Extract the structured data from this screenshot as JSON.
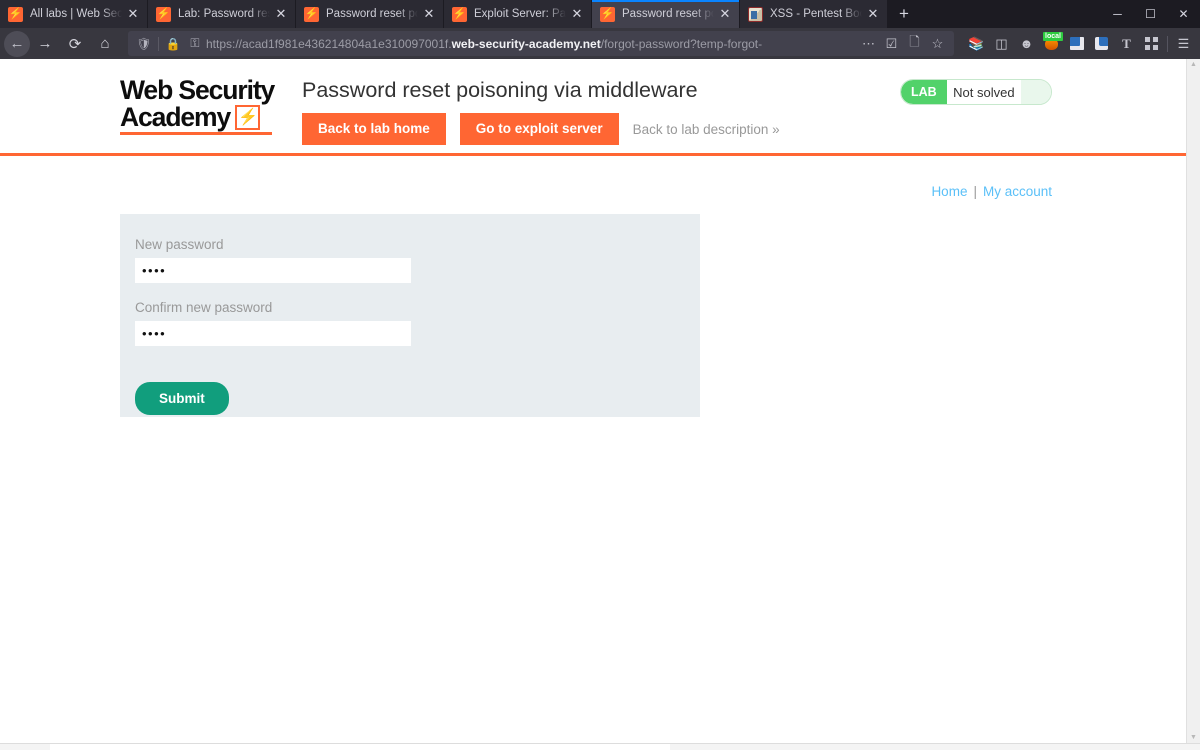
{
  "browser": {
    "tabs": [
      {
        "title": "All labs | Web Security Academy",
        "favicon": "burp-favicon",
        "active": false
      },
      {
        "title": "Lab: Password reset poisoning via middleware",
        "favicon": "burp-favicon",
        "active": false
      },
      {
        "title": "Password reset poisoning via middleware",
        "favicon": "burp-favicon",
        "active": false
      },
      {
        "title": "Exploit Server: Password reset poisoning via middleware",
        "favicon": "burp-favicon",
        "active": false
      },
      {
        "title": "Password reset poisoning via middleware",
        "favicon": "burp-favicon",
        "active": true
      },
      {
        "title": "XSS - Pentest Book",
        "favicon": "book-favicon",
        "active": false
      }
    ],
    "new_tab_label": "+",
    "window_controls": {
      "minimize": "–",
      "maximize": "❐",
      "close": "✕"
    },
    "nav": {
      "back": "←",
      "forward": "→",
      "reload": "↻",
      "home": "⌂"
    },
    "url": {
      "shield_icon": "⛊",
      "lock_icon": "ὑ2",
      "permissions_icon": "⚷",
      "prefix": "https://acad1f981e436214804a1e310097001f.",
      "domain": "web-security-academy.net",
      "path": "/forgot-password?temp-forgot-",
      "more_icon": "…",
      "reader_icon": "☑",
      "translate_icon": "὜b",
      "bookmark_icon": "☆"
    },
    "toolbar_icons": [
      "library-icon",
      "sidebar-icon",
      "account-icon",
      "burp-extension-icon",
      "extension-blue-icon",
      "extension-blue2-icon",
      "tampermonkey-icon",
      "grid-extensions-icon",
      "app-menu-icon"
    ],
    "burp_badge": "local"
  },
  "lab": {
    "logo": {
      "line1": "Web Security",
      "line2": "Academy",
      "bolt_icon": "⚡"
    },
    "title": "Password reset poisoning via middleware",
    "buttons": {
      "back_to_lab_home": "Back to lab home",
      "go_to_exploit_server": "Go to exploit server",
      "back_to_lab_description": "Back to lab description »"
    },
    "status": {
      "badge": "LAB",
      "text": "Not solved"
    }
  },
  "site": {
    "nav": {
      "home": "Home",
      "separator": "|",
      "my_account": "My account"
    },
    "form": {
      "new_password_label": "New password",
      "new_password_value": "••••",
      "confirm_password_label": "Confirm new password",
      "confirm_password_value": "••••",
      "submit_label": "Submit"
    }
  },
  "colors": {
    "accent_orange": "#ff6633",
    "submit_green": "#119e7d",
    "lab_badge_green": "#52d26a",
    "link_blue": "#5bc0f8",
    "panel_gray": "#e8edf0"
  }
}
